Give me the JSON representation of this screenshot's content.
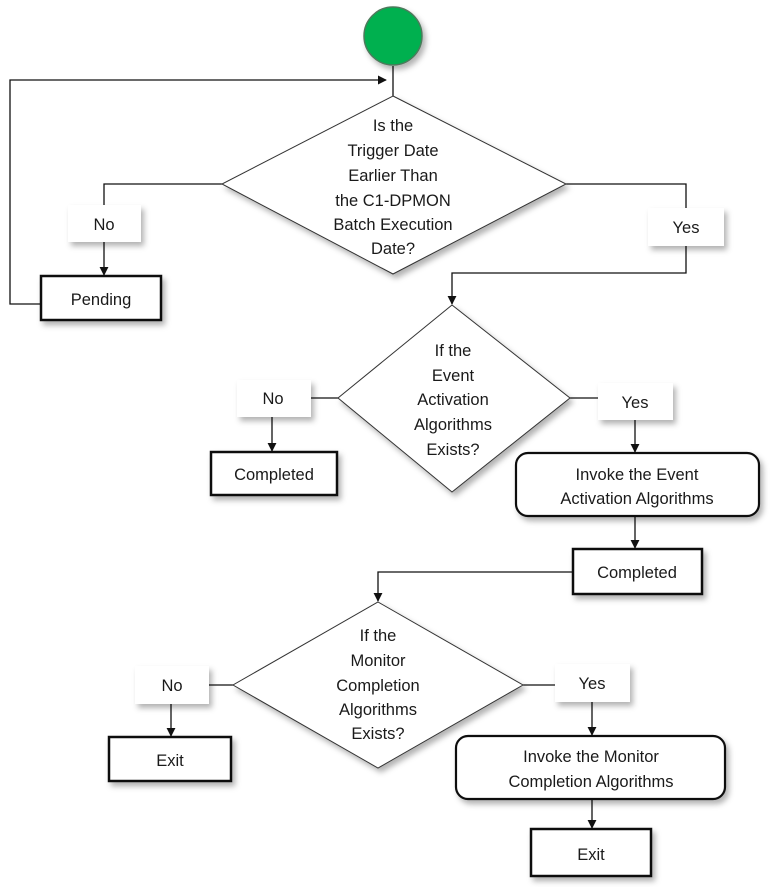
{
  "colors": {
    "start": "#00b050",
    "line": "#111111"
  },
  "start": {
    "icon": "start-circle"
  },
  "decision1": {
    "lines": [
      "Is the",
      "Trigger Date",
      "Earlier Than",
      "the C1-DPMON",
      "Batch Execution",
      "Date?"
    ],
    "no_label": "No",
    "yes_label": "Yes"
  },
  "pending": {
    "label": "Pending"
  },
  "decision2": {
    "lines": [
      "If the",
      "Event",
      "Activation",
      "Algorithms",
      "Exists?"
    ],
    "no_label": "No",
    "yes_label": "Yes"
  },
  "completed_no": {
    "label": "Completed"
  },
  "invoke_event": {
    "lines": [
      "Invoke the Event",
      "Activation Algorithms"
    ]
  },
  "completed_yes": {
    "label": "Completed"
  },
  "decision3": {
    "lines": [
      "If the",
      "Monitor",
      "Completion",
      "Algorithms",
      "Exists?"
    ],
    "no_label": "No",
    "yes_label": "Yes"
  },
  "exit_no": {
    "label": "Exit"
  },
  "invoke_monitor": {
    "lines": [
      "Invoke the Monitor",
      "Completion Algorithms"
    ]
  },
  "exit_yes": {
    "label": "Exit"
  }
}
